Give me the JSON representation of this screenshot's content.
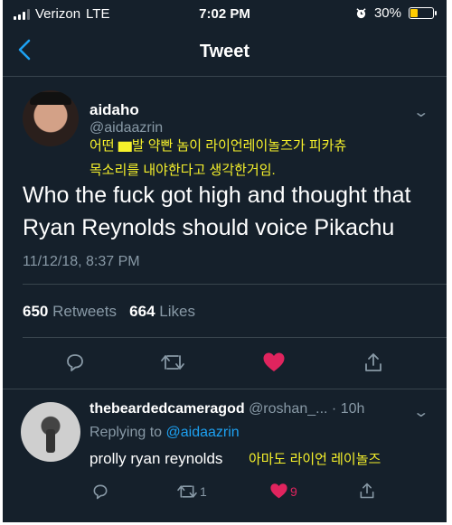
{
  "status_bar": {
    "carrier": "Verizon",
    "network": "LTE",
    "time": "7:02 PM",
    "battery": "30%",
    "battery_level": 0.3,
    "battery_color": "#ffcc00"
  },
  "header": {
    "title": "Tweet",
    "back_icon": "chevron-left-icon"
  },
  "tweet": {
    "name": "aidaho",
    "handle": "@aidaazrin",
    "korean_caption": [
      "어떤 ▆발 약빤 놈이 라이언레이놀즈가 피카츄",
      "목소리를 내야한다고 생각한거임."
    ],
    "text_lines": [
      "Who the fuck got high and thought that",
      "Ryan Reynolds should voice Pikachu"
    ],
    "timestamp": "11/12/18, 8:37 PM",
    "retweets": "650",
    "retweets_label": "Retweets",
    "likes": "664",
    "likes_label": "Likes"
  },
  "reply": {
    "name": "thebeardedcameragod",
    "handle": "@roshan_...",
    "time": "· 10h",
    "replying_prefix": "Replying to",
    "replying_to": "@aidaazrin",
    "text": "prolly ryan reynolds",
    "korean_caption": "아마도 라이언 레이놀즈",
    "retweet_count": "1",
    "like_count": "9"
  },
  "colors": {
    "background": "#15202b",
    "accent": "#1da1f2",
    "like": "#e0245e",
    "caption": "#f7f22b",
    "muted": "#8899a6"
  }
}
